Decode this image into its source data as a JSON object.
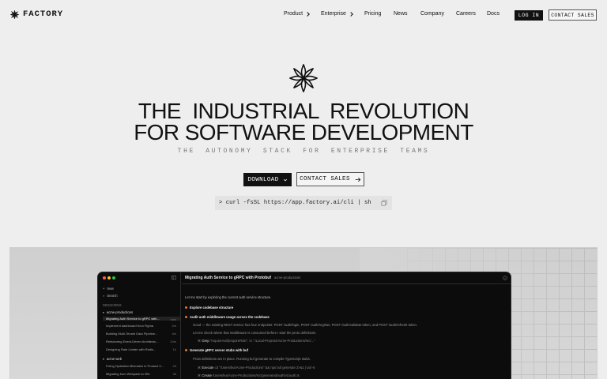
{
  "nav": {
    "brand": "FACTORY",
    "links": [
      {
        "label": "Product",
        "dropdown": true
      },
      {
        "label": "Enterprise",
        "dropdown": true
      },
      {
        "label": "Pricing",
        "dropdown": false
      },
      {
        "label": "News",
        "dropdown": false
      },
      {
        "label": "Company",
        "dropdown": false
      },
      {
        "label": "Careers",
        "dropdown": false
      },
      {
        "label": "Docs",
        "dropdown": false
      }
    ],
    "login_label": "LOG IN",
    "contact_label": "CONTACT SALES"
  },
  "hero": {
    "headline_line1": "THE  INDUSTRIAL  REVOLUTION",
    "headline_line2": "FOR SOFTWARE DEVELOPMENT",
    "subheadline": "THE AUTONOMY STACK FOR ENTERPRISE TEAMS",
    "download_label": "DOWNLOAD",
    "contact_label": "CONTACT SALES",
    "install_command": "> curl -fsSL https://app.factory.ai/cli | sh"
  },
  "app_preview": {
    "sidebar": {
      "new_label": "New",
      "search_label": "Search",
      "sessions_header": "SESSIONS",
      "groups": [
        {
          "name": "acme-productions",
          "items": [
            {
              "title": "Migrating Auth Service to gRPC with...",
              "time": "now",
              "active": true
            },
            {
              "title": "Implement dashboard from Figma",
              "time": "2m",
              "active": false
            },
            {
              "title": "Building Multi-Tenant Data Pipeline...",
              "time": "4m",
              "active": false
            },
            {
              "title": "Refactoring Event-Driven Architectu...",
              "time": "10m",
              "active": false
            },
            {
              "title": "Designing Rate Limiter with Redis...",
              "time": "1h",
              "active": false
            }
          ]
        },
        {
          "name": "acme-web",
          "items": [
            {
              "title": "Fixing Hydration Mismatch in Product C...",
              "time": "2d",
              "active": false
            },
            {
              "title": "Migrating from Webpack to Vite",
              "time": "3d",
              "active": false
            }
          ]
        }
      ]
    },
    "main": {
      "title": "Migrating Auth Service to gRPC with Protobuf",
      "tag": "acme-productions",
      "lines": {
        "intro": "Let me start by exploring the current auth service structure.",
        "step1": "Explore codebase structure",
        "step2": "Audit auth middleware usage across the codebase",
        "step2_detail": "Good — the existing REST service has four endpoints: POST /auth/login, POST /auth/register, POST /auth/validate-token, and POST /auth/refresh-token.",
        "step2_detail2": "Let me check where that middleware is consumed before I start the proto definitions.",
        "grep_tool": "Grep",
        "grep_args": "\"requireAuth|requireRole\", in \"./Local-Projects/Acme-Productions/src/...\"",
        "step3": "Generate gRPC server stubs with buf",
        "step3_detail": "Proto definitions are in place. Running buf generate to compile TypeScript stubs.",
        "execute_tool": "Execute",
        "execute_args": "cd \"/Users/lea/Acme-Productions\" && npx buf generate 2>&1 | tail -5",
        "create_tool": "Create",
        "create_args": "/Users/lea/Acme-Productions/src/generated/auth/v1/auth.ts"
      }
    }
  },
  "colors": {
    "background": "#eeeeee",
    "ink": "#111111",
    "accent_bullet": "#e8752a",
    "terminal_bg": "#0c0c0c"
  }
}
